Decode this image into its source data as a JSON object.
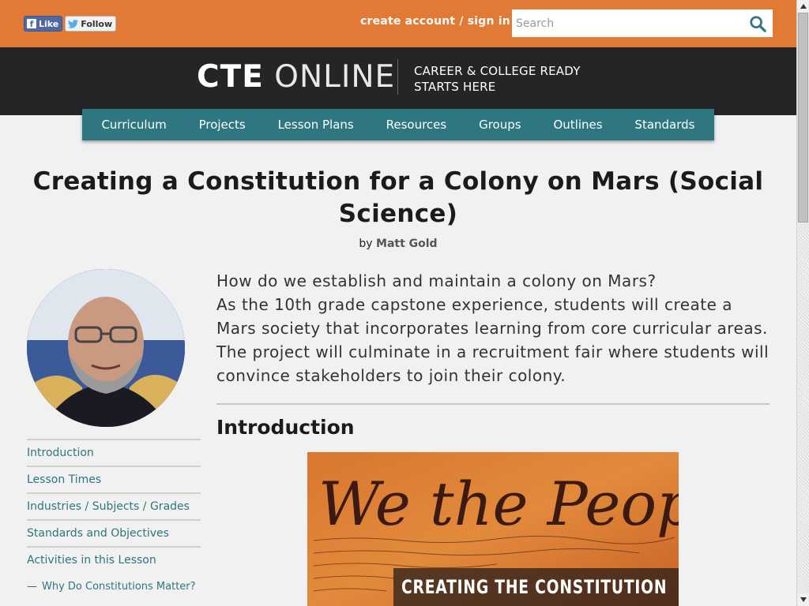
{
  "social": {
    "like_label": "Like",
    "follow_label": "Follow"
  },
  "account": {
    "signin_text": "create account / sign in"
  },
  "search": {
    "placeholder": "Search"
  },
  "brand": {
    "logo_bold": "CTE",
    "logo_light": "ONLINE",
    "tagline_line1": "CAREER & COLLEGE READY",
    "tagline_line2": "STARTS HERE"
  },
  "nav": {
    "items": [
      "Curriculum",
      "Projects",
      "Lesson Plans",
      "Resources",
      "Groups",
      "Outlines",
      "Standards"
    ]
  },
  "page": {
    "title": "Creating a Constitution for a Colony on Mars (Social Science)",
    "by_prefix": "by",
    "author": "Matt Gold",
    "lead_question": "How do we establish and maintain a colony on Mars?",
    "lead_body": "As the 10th grade capstone experience, students will create a Mars society that incorporates learning from core curricular areas. The project will culminate in a recruitment fair where students will convince stakeholders to join their colony.",
    "intro_heading": "Introduction",
    "hero_caption": "CREATING THE CONSTITUTION",
    "hero_script": "We the People"
  },
  "sidebar": {
    "items": [
      "Introduction",
      "Lesson Times",
      "Industries / Subjects / Grades",
      "Standards and Objectives",
      "Activities in this Lesson"
    ],
    "sub_item": "Why Do Constitutions Matter?",
    "sub_dash": "—"
  },
  "colors": {
    "topbar": "#e07a35",
    "header": "#252527",
    "nav": "#2e7680",
    "link": "#2e7680"
  }
}
